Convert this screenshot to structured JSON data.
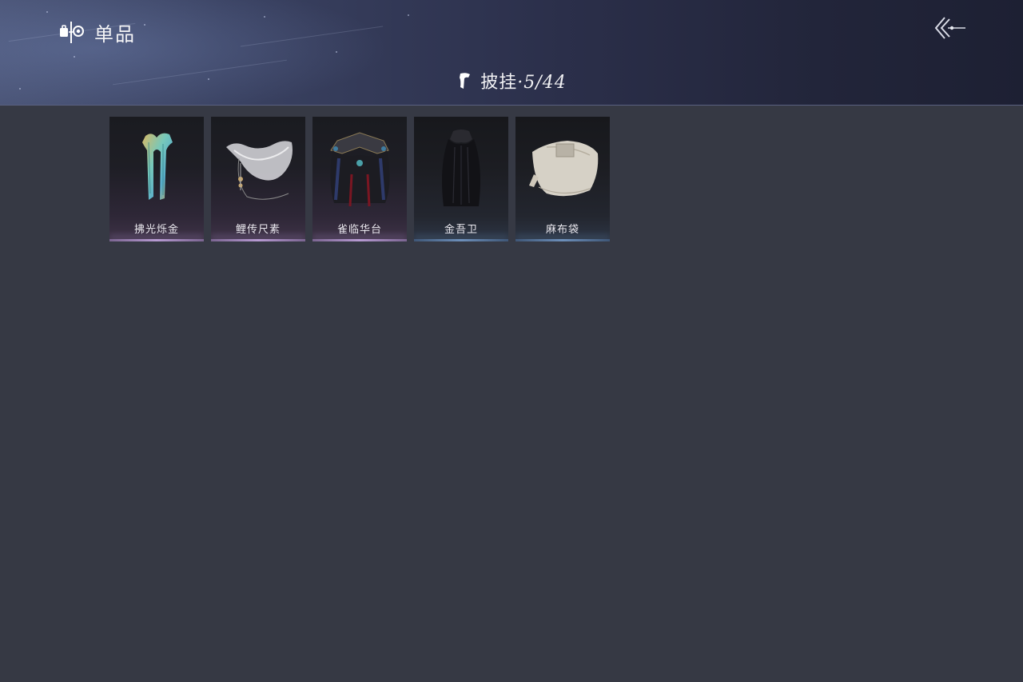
{
  "header": {
    "title": "单品",
    "title_icon": "outfit-category-icon",
    "back_icon": "back-arrow-icon"
  },
  "category": {
    "icon": "cape-icon",
    "name": "披挂",
    "separator": "·",
    "count": "5/44"
  },
  "items": [
    {
      "name": "拂光烁金",
      "icon": "iridescent-shawl-icon",
      "rarity": "purple"
    },
    {
      "name": "鲤传尺素",
      "icon": "white-veil-scarf-icon",
      "rarity": "purple"
    },
    {
      "name": "雀临华台",
      "icon": "ornate-black-cape-icon",
      "rarity": "purple"
    },
    {
      "name": "金吾卫",
      "icon": "black-hooded-cloak-icon",
      "rarity": "blue"
    },
    {
      "name": "麻布袋",
      "icon": "burlap-sack-icon",
      "rarity": "blue"
    }
  ],
  "colors": {
    "background": "#363944",
    "rarity_purple": "#b79ad2",
    "rarity_blue": "#6d8fba"
  }
}
